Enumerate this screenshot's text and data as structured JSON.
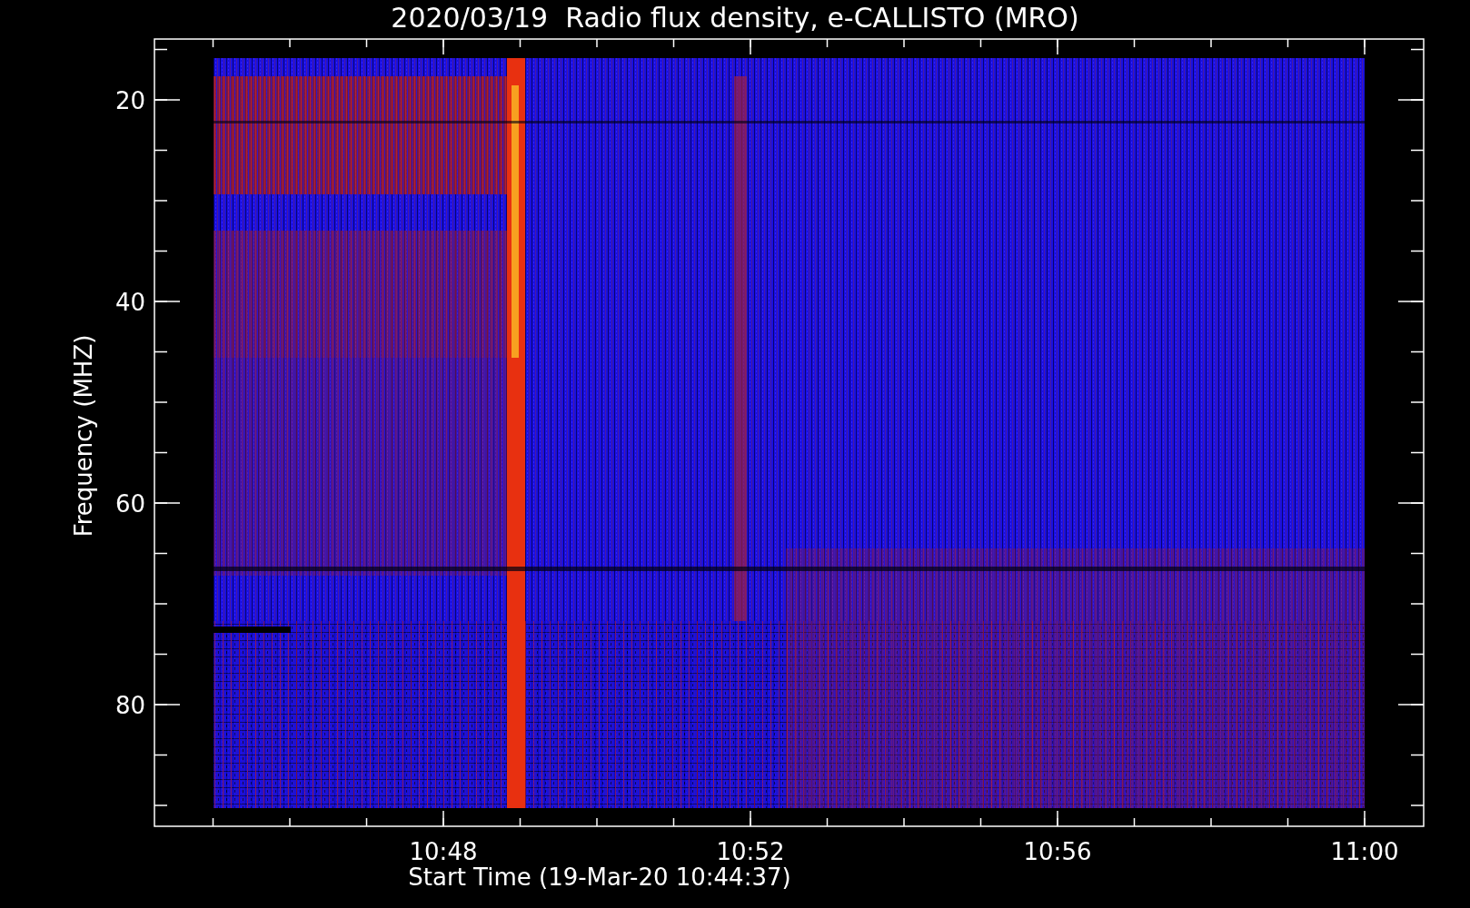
{
  "title": "2020/03/19  Radio flux density, e-CALLISTO (MRO)",
  "ylabel": "Frequency (MHZ)",
  "xlabel": "Start Time (19-Mar-20 10:44:37)",
  "yticks": [
    "20",
    "40",
    "60",
    "80"
  ],
  "xticks": [
    "10:48",
    "10:52",
    "10:56",
    "11:00"
  ]
}
